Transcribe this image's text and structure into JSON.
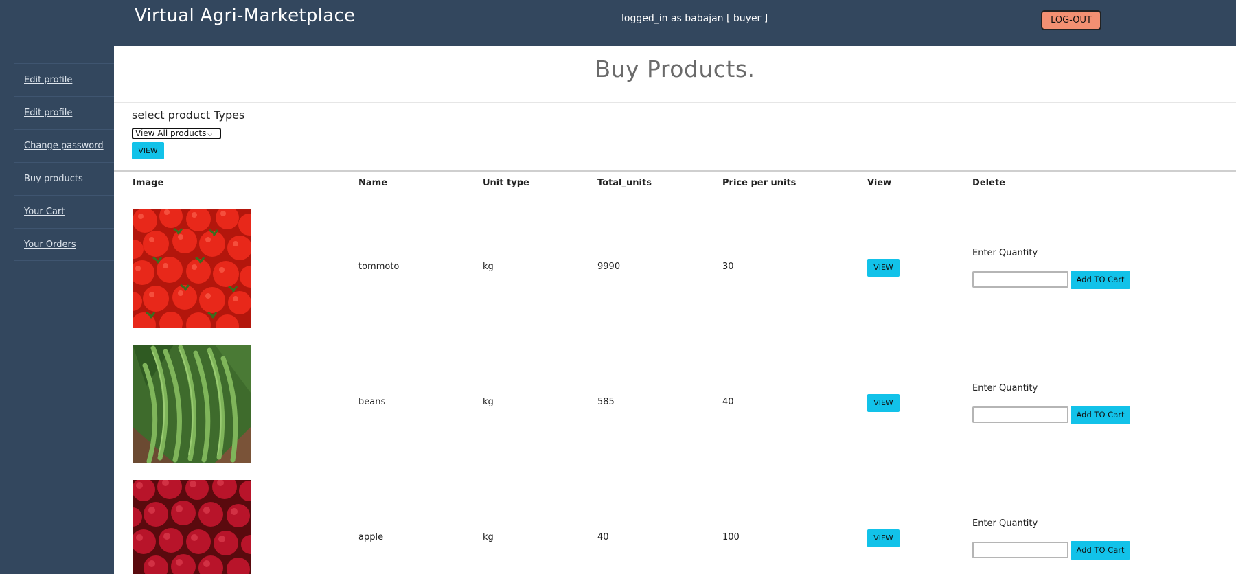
{
  "header": {
    "title": "Virtual Agri-Marketplace",
    "login_status": "logged_in as babajan [ buyer ]",
    "logout_label": "LOG-OUT"
  },
  "sidebar": {
    "items": [
      {
        "label": "Edit profile"
      },
      {
        "label": "Edit profile"
      },
      {
        "label": "Change password"
      },
      {
        "label": "Buy products"
      },
      {
        "label": "Your Cart"
      },
      {
        "label": "Your Orders"
      }
    ]
  },
  "main": {
    "heading": "Buy Products.",
    "filter_label": "select product Types",
    "filter_selected": "View All products",
    "filter_button": "VIEW"
  },
  "table": {
    "headers": [
      "Image",
      "Name",
      "Unit type",
      "Total_units",
      "Price per units",
      "View",
      "Delete"
    ],
    "rows": [
      {
        "name": "tommoto",
        "unit": "kg",
        "total": "9990",
        "price": "30",
        "view_label": "VIEW",
        "qty_label": "Enter Quantity",
        "qty_value": "",
        "add_label": "Add TO Cart",
        "image": "tomato-photo"
      },
      {
        "name": "beans",
        "unit": "kg",
        "total": "585",
        "price": "40",
        "view_label": "VIEW",
        "qty_label": "Enter Quantity",
        "qty_value": "",
        "add_label": "Add TO Cart",
        "image": "beans-photo"
      },
      {
        "name": "apple",
        "unit": "kg",
        "total": "40",
        "price": "100",
        "view_label": "VIEW",
        "qty_label": "Enter Quantity",
        "qty_value": "",
        "add_label": "Add TO Cart",
        "image": "apple-photo"
      }
    ]
  },
  "colors": {
    "navbar": "#33475e",
    "accent_button": "#12c2e9",
    "logout_button": "#f39072",
    "heading_text": "#6a6a6a"
  }
}
